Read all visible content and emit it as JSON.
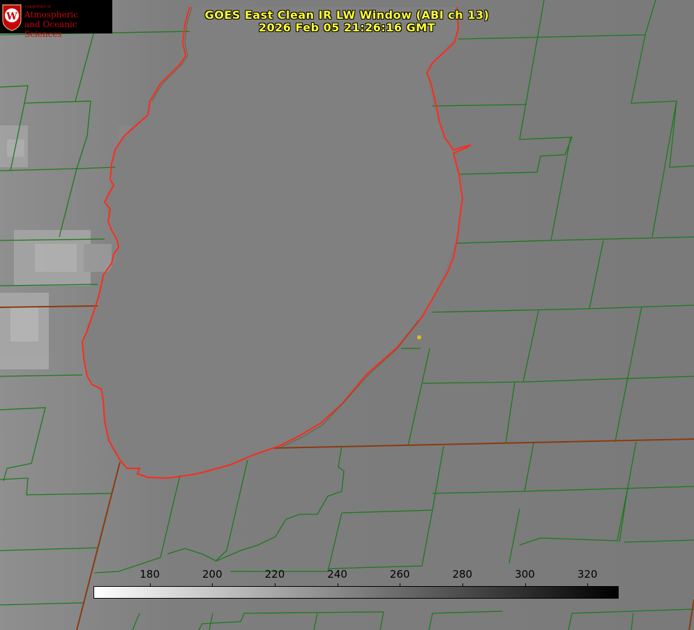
{
  "title": {
    "line1": "GOES East Clean IR LW Window (ABI ch 13)",
    "line2": "2026 Feb 05 21:26:16 GMT"
  },
  "logo": {
    "dept": "Department of",
    "line1": "Atmospheric",
    "line2": "and Oceanic Sciences",
    "emblem_letter": "W"
  },
  "colorbar": {
    "min": 162,
    "max": 330,
    "ticks": [
      "180",
      "200",
      "220",
      "240",
      "260",
      "280",
      "300",
      "320"
    ],
    "colors": {
      "low": "#ffffff",
      "high": "#000000"
    }
  },
  "colors": {
    "title": "#ffff33",
    "county_lines": "#1a7a1a",
    "state_lines": "#8a3a10",
    "coastline": "#ff2a1a",
    "marker": "#d4c21e"
  }
}
